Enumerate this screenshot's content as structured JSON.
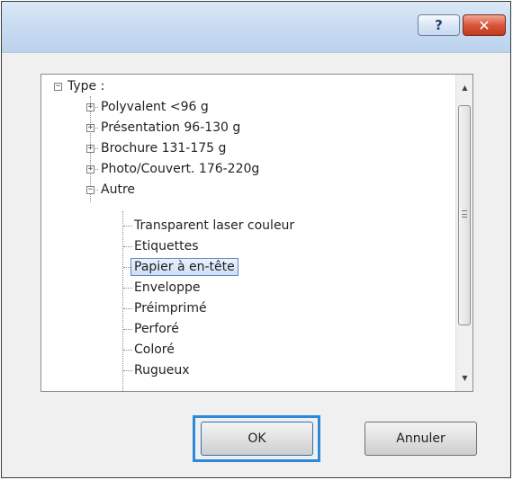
{
  "titlebar": {
    "help_icon": "?",
    "close_icon": "✕"
  },
  "tree": {
    "root": {
      "label": "Type :",
      "expander": "−"
    },
    "categories": [
      {
        "label": "Polyvalent <96 g",
        "expander": "+"
      },
      {
        "label": "Présentation 96-130 g",
        "expander": "+"
      },
      {
        "label": "Brochure 131-175 g",
        "expander": "+"
      },
      {
        "label": "Photo/Couvert. 176-220g",
        "expander": "+"
      },
      {
        "label": "Autre",
        "expander": "−"
      }
    ],
    "autre_children": [
      "Transparent laser couleur",
      "Etiquettes",
      "Papier à en-tête",
      "Enveloppe",
      "Préimprimé",
      "Perforé",
      "Coloré",
      "Rugueux"
    ],
    "selected_item": "Papier à en-tête"
  },
  "buttons": {
    "ok_label": "OK",
    "cancel_label": "Annuler"
  }
}
